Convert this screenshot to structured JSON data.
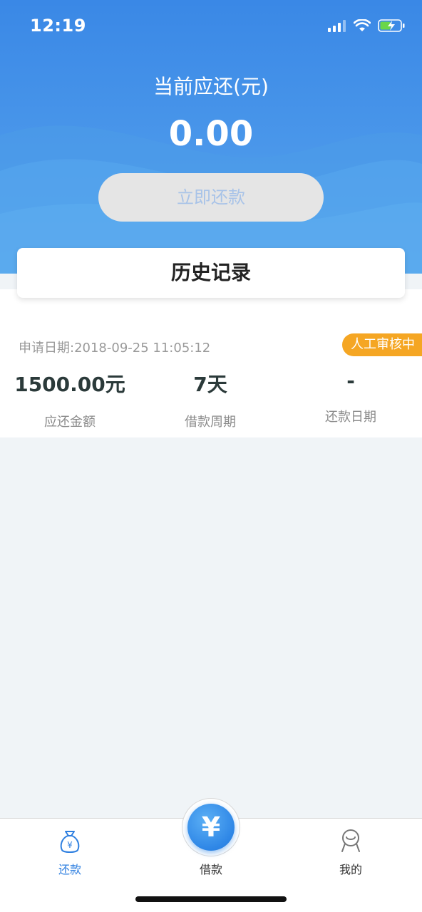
{
  "status_bar": {
    "time": "12:19"
  },
  "header": {
    "title": "当前应还(元)",
    "amount": "0.00",
    "repay_button": "立即还款"
  },
  "history": {
    "title": "历史记录"
  },
  "record": {
    "apply_date": "申请日期:2018-09-25 11:05:12",
    "status": "人工审核中",
    "amount_value": "1500.00元",
    "amount_label": "应还金额",
    "period_value": "7天",
    "period_label": "借款周期",
    "repay_date_value": "-",
    "repay_date_label": "还款日期"
  },
  "nav": {
    "items": [
      {
        "label": "还款",
        "icon": "money-bag-icon"
      },
      {
        "label": "借款",
        "icon": "yen-icon"
      },
      {
        "label": "我的",
        "icon": "user-icon"
      }
    ],
    "center_symbol": "¥"
  },
  "colors": {
    "header_blue": "#3a88e6",
    "accent_blue": "#2e7fe0",
    "badge_orange": "#f5a623"
  }
}
